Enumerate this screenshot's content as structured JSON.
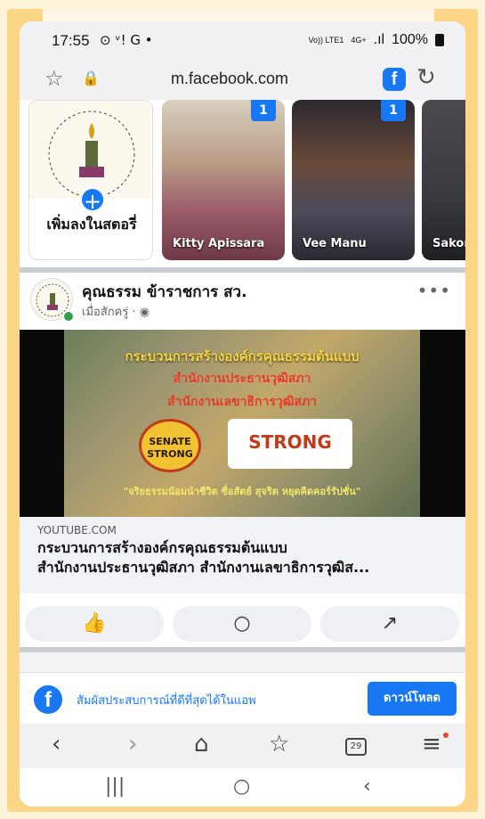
{
  "status_bar": {
    "time": "17:55",
    "left_icons": "⊙ ᵛ! G •",
    "vol_text": "Vo)) LTE1",
    "net_text": "4G+",
    "signal": ".ıl",
    "battery": "100%"
  },
  "url_bar": {
    "url": "m.facebook.com",
    "fb_letter": "f"
  },
  "stories": {
    "create_label": "เพิ่มลงในสตอรี่",
    "create_plus": "+",
    "items": [
      {
        "name": "Kitty Apissara",
        "badge": "1"
      },
      {
        "name": "Vee Manu",
        "badge": "1"
      },
      {
        "name": "Sakon Thaik",
        "badge": ""
      }
    ]
  },
  "post": {
    "author": "คุณธรรม ข้าราชการ สว.",
    "time": "เมื่อสักครู่ · ◉",
    "more": "•••",
    "image_text": {
      "line1": "กระบวนการสร้างองค์กรคุณธรรมต้นแบบ",
      "line2": "สำนักงานประธานวุฒิสภา",
      "line3": "สำนักงานเลขาธิการวุฒิสภา",
      "senate": "SENATE STRONG",
      "strong": "STRONG",
      "line4": "\"จริยธรรมน้อมนำชีวิต ซื่อสัตย์ สุจริต หยุดคิดคอร์รัปชั่น\""
    },
    "link_source": "YOUTUBE.COM",
    "link_title_1": "กระบวนการสร้างองค์กรคุณธรรมต้นแบบ",
    "link_title_2": "สำนักงานประธานวุฒิสภา สำนักงานเลขาธิการวุฒิส..."
  },
  "actions": {
    "like": "👍",
    "comment": "○",
    "share": "↗"
  },
  "banner": {
    "message": "สัมผัสประสบการณ์ที่ดีที่สุดได้ในแอพ",
    "download": "ดาวน์โหลด",
    "fb_letter": "f"
  },
  "nav": {
    "back": "‹",
    "forward": "›",
    "home": "⌂",
    "bookmark": "☆",
    "tabs": "29",
    "menu": "≡"
  },
  "system_nav": {
    "recent": "|||",
    "home": "○",
    "back": "‹"
  }
}
